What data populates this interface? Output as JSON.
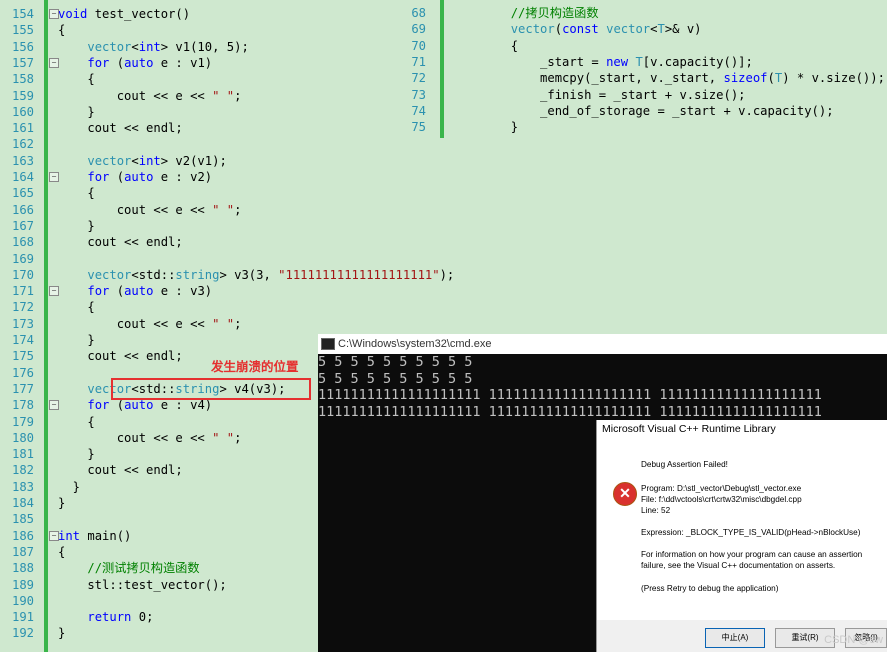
{
  "editor": {
    "lines": [
      {
        "n": "154",
        "html": "<span class='kw'>void</span> test_vector()"
      },
      {
        "n": "155",
        "html": "{"
      },
      {
        "n": "156",
        "html": "    <span class='ty'>vector</span>&lt;<span class='kw'>int</span>&gt; v1(10, 5);"
      },
      {
        "n": "157",
        "html": "    <span class='kw'>for</span> (<span class='kw'>auto</span> e : v1)"
      },
      {
        "n": "158",
        "html": "    {"
      },
      {
        "n": "159",
        "html": "        cout &lt;&lt; e &lt;&lt; <span class='st'>\" \"</span>;"
      },
      {
        "n": "160",
        "html": "    }"
      },
      {
        "n": "161",
        "html": "    cout &lt;&lt; endl;"
      },
      {
        "n": "162",
        "html": ""
      },
      {
        "n": "163",
        "html": "    <span class='ty'>vector</span>&lt;<span class='kw'>int</span>&gt; v2(v1);"
      },
      {
        "n": "164",
        "html": "    <span class='kw'>for</span> (<span class='kw'>auto</span> e : v2)"
      },
      {
        "n": "165",
        "html": "    {"
      },
      {
        "n": "166",
        "html": "        cout &lt;&lt; e &lt;&lt; <span class='st'>\" \"</span>;"
      },
      {
        "n": "167",
        "html": "    }"
      },
      {
        "n": "168",
        "html": "    cout &lt;&lt; endl;"
      },
      {
        "n": "169",
        "html": ""
      },
      {
        "n": "170",
        "html": "    <span class='ty'>vector</span>&lt;std::<span class='ty'>string</span>&gt; v3(3, <span class='st'>\"11111111111111111111\"</span>);"
      },
      {
        "n": "171",
        "html": "    <span class='kw'>for</span> (<span class='kw'>auto</span> e : v3)"
      },
      {
        "n": "172",
        "html": "    {"
      },
      {
        "n": "173",
        "html": "        cout &lt;&lt; e &lt;&lt; <span class='st'>\" \"</span>;"
      },
      {
        "n": "174",
        "html": "    }"
      },
      {
        "n": "175",
        "html": "    cout &lt;&lt; endl;"
      },
      {
        "n": "176",
        "html": ""
      },
      {
        "n": "177",
        "html": "    <span class='ty'>vector</span>&lt;std::<span class='ty'>string</span>&gt; v4(v3);"
      },
      {
        "n": "178",
        "html": "    <span class='kw'>for</span> (<span class='kw'>auto</span> e : v4)"
      },
      {
        "n": "179",
        "html": "    {"
      },
      {
        "n": "180",
        "html": "        cout &lt;&lt; e &lt;&lt; <span class='st'>\" \"</span>;"
      },
      {
        "n": "181",
        "html": "    }"
      },
      {
        "n": "182",
        "html": "    cout &lt;&lt; endl;"
      },
      {
        "n": "183",
        "html": "  }"
      },
      {
        "n": "184",
        "html": "}"
      },
      {
        "n": "185",
        "html": ""
      },
      {
        "n": "186",
        "html": "<span class='kw'>int</span> main()"
      },
      {
        "n": "187",
        "html": "{"
      },
      {
        "n": "188",
        "html": "    <span class='cm'>//测试拷贝构造函数</span>"
      },
      {
        "n": "189",
        "html": "    stl::test_vector();"
      },
      {
        "n": "190",
        "html": ""
      },
      {
        "n": "191",
        "html": "    <span class='kw'>return</span> 0;"
      },
      {
        "n": "192",
        "html": "}"
      }
    ],
    "right_lines": [
      {
        "n": "68",
        "html": "        <span class='cm'>//拷贝构造函数</span>"
      },
      {
        "n": "69",
        "html": "        <span class='ty'>vector</span>(<span class='kw'>const</span> <span class='ty'>vector</span>&lt;<span class='ty'>T</span>&gt;&amp; v)"
      },
      {
        "n": "70",
        "html": "        {"
      },
      {
        "n": "71",
        "html": "            _start = <span class='kw'>new</span> <span class='ty'>T</span>[v.capacity()];"
      },
      {
        "n": "72",
        "html": "            memcpy(_start, v._start, <span class='kw'>sizeof</span>(<span class='ty'>T</span>) * v.size());"
      },
      {
        "n": "73",
        "html": "            _finish = _start + v.size();"
      },
      {
        "n": "74",
        "html": "            _end_of_storage = _start + v.capacity();"
      },
      {
        "n": "75",
        "html": "        }"
      }
    ]
  },
  "annotation": "发生崩溃的位置",
  "cmd": {
    "title": "C:\\Windows\\system32\\cmd.exe",
    "output": "5 5 5 5 5 5 5 5 5 5\n5 5 5 5 5 5 5 5 5 5\n11111111111111111111 11111111111111111111 11111111111111111111\n11111111111111111111 11111111111111111111 11111111111111111111"
  },
  "dialog": {
    "title": "Microsoft Visual C++ Runtime Library",
    "heading": "Debug Assertion Failed!",
    "program": "Program: D:\\stl_vector\\Debug\\stl_vector.exe",
    "file": "File: f:\\dd\\vctools\\crt\\crtw32\\misc\\dbgdel.cpp",
    "line": "Line: 52",
    "expression": "Expression: _BLOCK_TYPE_IS_VALID(pHead->nBlockUse)",
    "info1": "For information on how your program can cause an assertion",
    "info2": "failure, see the Visual C++ documentation on asserts.",
    "retry": "(Press Retry to debug the application)",
    "btn_abort": "中止(A)",
    "btn_retry": "重试(R)",
    "btn_ignore": "忽略(I)"
  },
  "watermark": "CSDN @sw"
}
